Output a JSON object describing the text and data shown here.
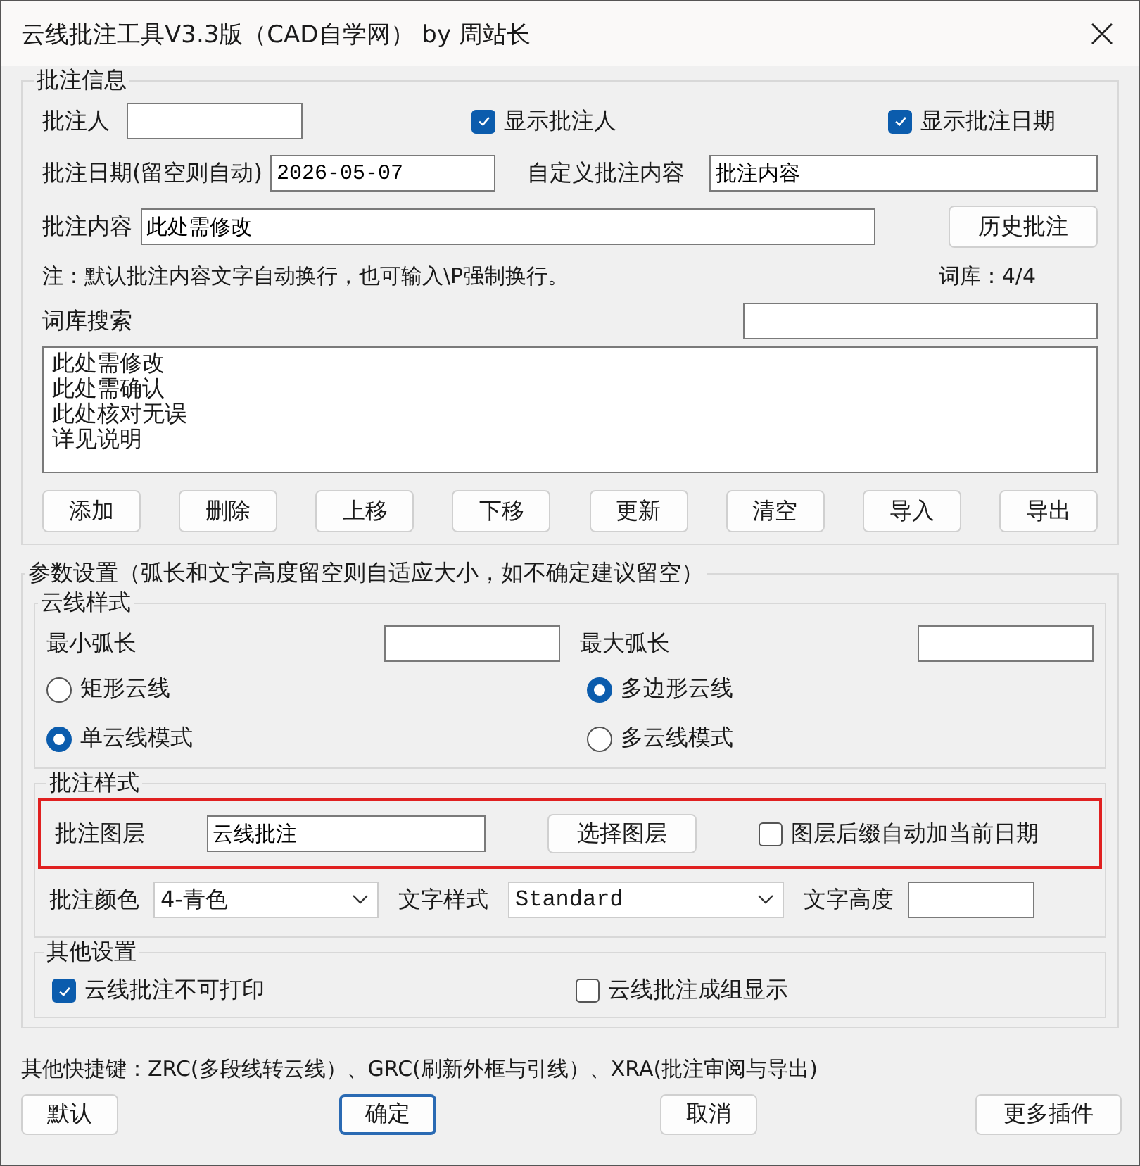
{
  "window": {
    "title": "云线批注工具V3.3版（CAD自学网） by 周站长"
  },
  "info": {
    "legend": "批注信息",
    "annotator": {
      "label": "批注人"
    },
    "show_annotator": {
      "label": "显示批注人",
      "checked": true
    },
    "show_date": {
      "label": "显示批注日期",
      "checked": true
    },
    "date": {
      "label": "批注日期(留空则自动)",
      "value": "2026-05-07"
    },
    "custom": {
      "label": "自定义批注内容",
      "value": "批注内容"
    },
    "content": {
      "label": "批注内容",
      "value": "此处需修改"
    },
    "history_button": "历史批注",
    "note": "注：默认批注内容文字自动换行，也可输入\\P强制换行。",
    "library_count": "词库：4/4",
    "search": {
      "label": "词库搜索"
    },
    "list_items": [
      "此处需修改",
      "此处需确认",
      "此处核对无误",
      "详见说明"
    ],
    "buttons": [
      "添加",
      "删除",
      "上移",
      "下移",
      "更新",
      "清空",
      "导入",
      "导出"
    ]
  },
  "params": {
    "legend": "参数设置（弧长和文字高度留空则自适应大小，如不确定建议留空）",
    "cloud_style": {
      "legend": "云线样式",
      "min_arc": {
        "label": "最小弧长"
      },
      "max_arc": {
        "label": "最大弧长"
      },
      "shape_options": [
        {
          "label": "矩形云线",
          "selected": false
        },
        {
          "label": "多边形云线",
          "selected": true
        }
      ],
      "mode_options": [
        {
          "label": "单云线模式",
          "selected": true
        },
        {
          "label": "多云线模式",
          "selected": false
        }
      ]
    },
    "annotation_style": {
      "legend": "批注样式",
      "highlighted": true,
      "layer": {
        "label": "批注图层",
        "value": "云线批注"
      },
      "select_layer_button": "选择图层",
      "append_date": {
        "label": "图层后缀自动加当前日期",
        "checked": false
      },
      "color": {
        "label": "批注颜色",
        "value": "4-青色"
      },
      "text_style": {
        "label": "文字样式",
        "value": "Standard"
      },
      "text_height": {
        "label": "文字高度"
      }
    },
    "other": {
      "legend": "其他设置",
      "options": [
        {
          "label": "云线批注不可打印",
          "checked": true
        },
        {
          "label": "云线批注成组显示",
          "checked": false
        }
      ]
    }
  },
  "shortcuts": "其他快捷键：ZRC(多段线转云线）、GRC(刷新外框与引线）、XRA(批注审阅与导出)",
  "footer_buttons": [
    {
      "label": "默认",
      "default": false
    },
    {
      "label": "确定",
      "default": true
    },
    {
      "label": "取消",
      "default": false
    },
    {
      "label": "更多插件",
      "default": false
    }
  ]
}
